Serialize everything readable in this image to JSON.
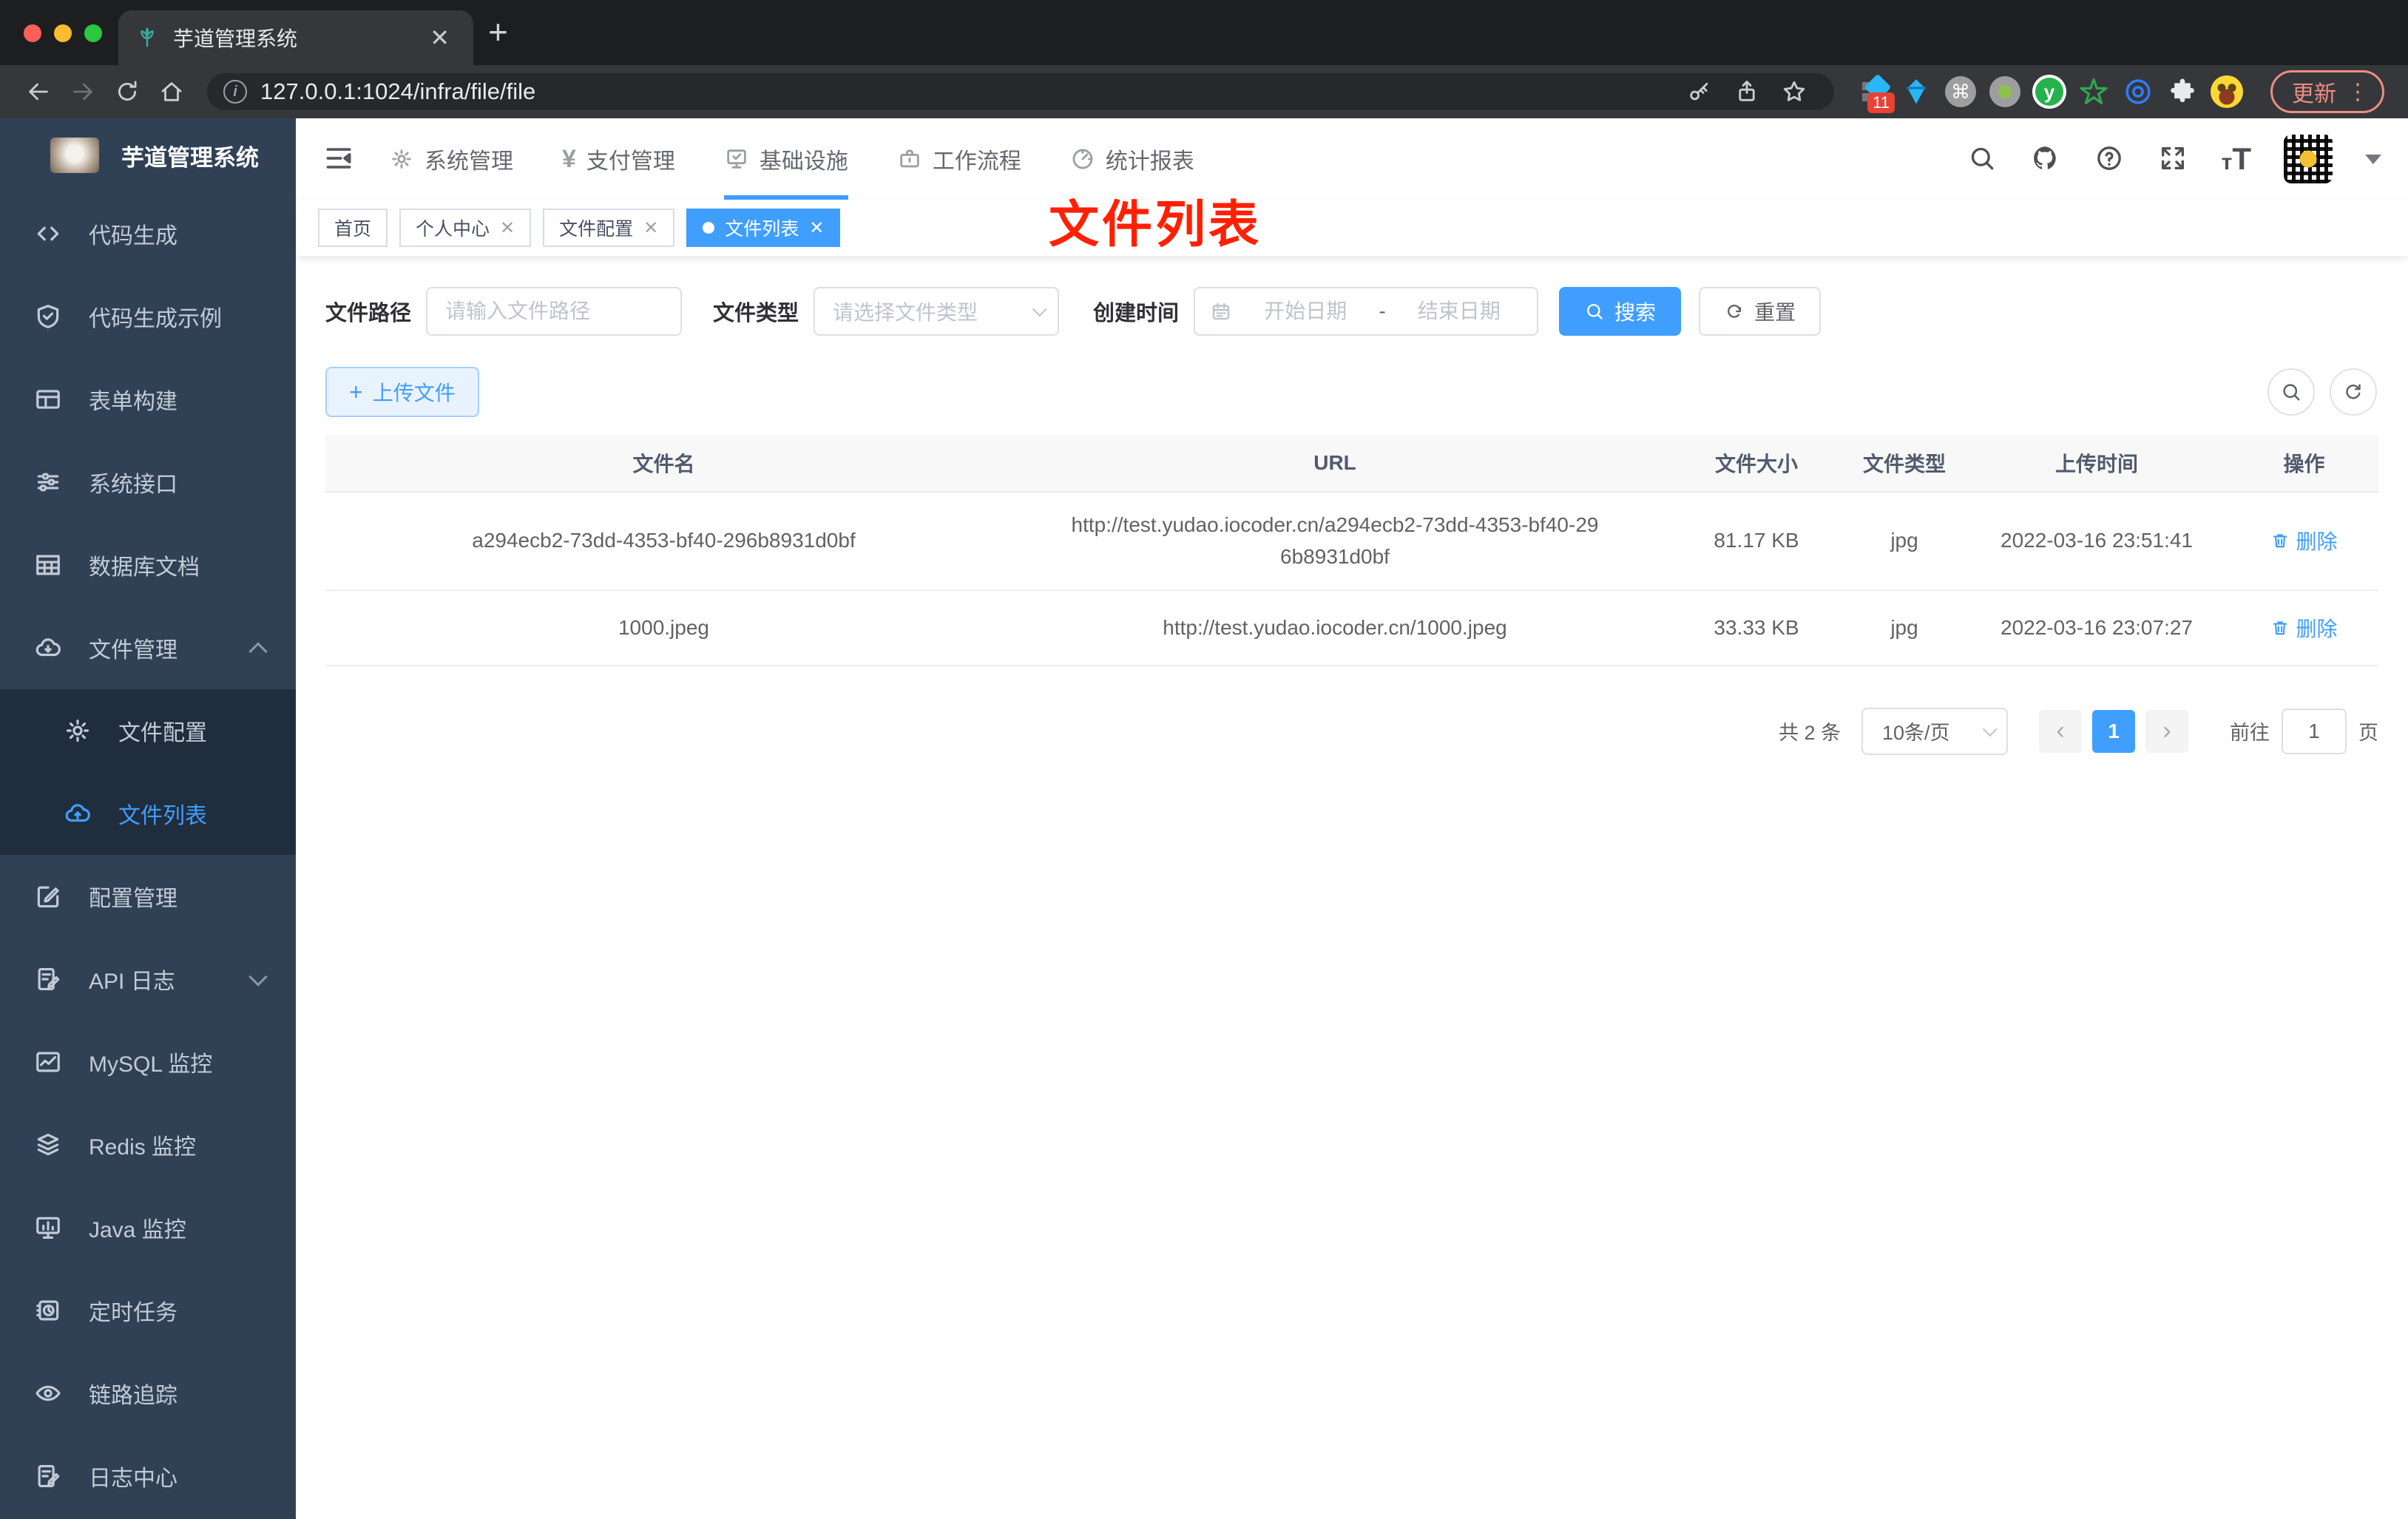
{
  "browser": {
    "tab_title": "芋道管理系统",
    "url": "127.0.0.1:1024/infra/file/file",
    "extension_badge": "11",
    "update_label": "更新"
  },
  "sidebar": {
    "title": "芋道管理系统",
    "items": [
      {
        "label": "代码生成"
      },
      {
        "label": "代码生成示例"
      },
      {
        "label": "表单构建"
      },
      {
        "label": "系统接口"
      },
      {
        "label": "数据库文档"
      },
      {
        "label": "文件管理"
      },
      {
        "label": "文件配置"
      },
      {
        "label": "文件列表"
      },
      {
        "label": "配置管理"
      },
      {
        "label": "API 日志"
      },
      {
        "label": "MySQL 监控"
      },
      {
        "label": "Redis 监控"
      },
      {
        "label": "Java 监控"
      },
      {
        "label": "定时任务"
      },
      {
        "label": "链路追踪"
      },
      {
        "label": "日志中心"
      }
    ]
  },
  "topnav": {
    "items": [
      {
        "label": "系统管理"
      },
      {
        "label": "支付管理"
      },
      {
        "label": "基础设施",
        "active": true
      },
      {
        "label": "工作流程"
      },
      {
        "label": "统计报表"
      }
    ]
  },
  "tags": [
    {
      "label": "首页"
    },
    {
      "label": "个人中心"
    },
    {
      "label": "文件配置"
    },
    {
      "label": "文件列表",
      "active": true
    }
  ],
  "annotation": "文件列表",
  "filters": {
    "path_label": "文件路径",
    "path_placeholder": "请输入文件路径",
    "type_label": "文件类型",
    "type_placeholder": "请选择文件类型",
    "time_label": "创建时间",
    "start_placeholder": "开始日期",
    "range_separator": "-",
    "end_placeholder": "结束日期",
    "search_label": "搜索",
    "reset_label": "重置"
  },
  "actions": {
    "upload_label": "上传文件"
  },
  "table": {
    "headers": [
      "文件名",
      "URL",
      "文件大小",
      "文件类型",
      "上传时间",
      "操作"
    ],
    "rows": [
      {
        "name": "a294ecb2-73dd-4353-bf40-296b8931d0bf",
        "url": "http://test.yudao.iocoder.cn/a294ecb2-73dd-4353-bf40-296b8931d0bf",
        "size": "81.17 KB",
        "type": "jpg",
        "time": "2022-03-16 23:51:41",
        "action": "删除"
      },
      {
        "name": "1000.jpeg",
        "url": "http://test.yudao.iocoder.cn/1000.jpeg",
        "size": "33.33 KB",
        "type": "jpg",
        "time": "2022-03-16 23:07:27",
        "action": "删除"
      }
    ]
  },
  "pagination": {
    "total": "共 2 条",
    "page_size": "10条/页",
    "current_page": "1",
    "goto_label": "前往",
    "goto_value": "1",
    "page_unit": "页"
  },
  "colors": {
    "primary": "#409eff",
    "sidebar_bg": "#304156",
    "submenu_bg": "#1f2d3d",
    "annotation_red": "#ff2000"
  }
}
